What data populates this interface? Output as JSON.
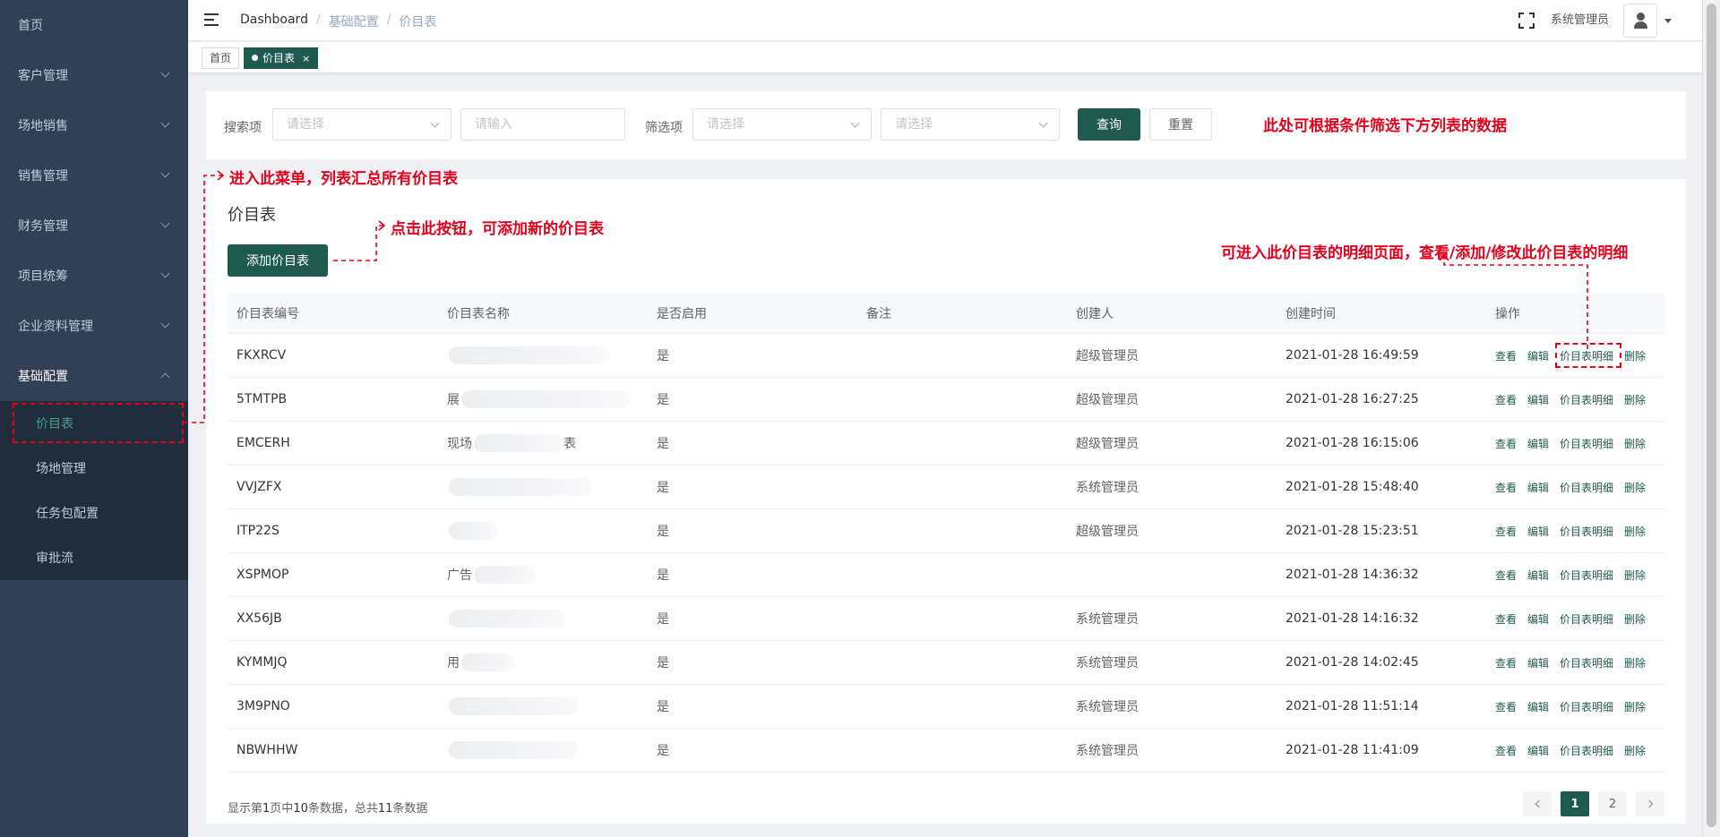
{
  "sidebar": {
    "items": [
      {
        "label": "首页",
        "has_children": false
      },
      {
        "label": "客户管理",
        "has_children": true
      },
      {
        "label": "场地销售",
        "has_children": true
      },
      {
        "label": "销售管理",
        "has_children": true
      },
      {
        "label": "财务管理",
        "has_children": true
      },
      {
        "label": "项目统筹",
        "has_children": true
      },
      {
        "label": "企业资料管理",
        "has_children": true
      },
      {
        "label": "基础配置",
        "has_children": true,
        "expanded": true
      }
    ],
    "sub_items": [
      {
        "label": "价目表",
        "active": true
      },
      {
        "label": "场地管理"
      },
      {
        "label": "任务包配置"
      },
      {
        "label": "审批流"
      }
    ],
    "colors": {
      "bg": "#304156",
      "sub_bg": "#1f2d3d",
      "active_text": "#4fa08a"
    }
  },
  "header": {
    "breadcrumb": [
      "Dashboard",
      "基础配置",
      "价目表"
    ],
    "username": "系统管理员"
  },
  "tags": [
    {
      "label": "首页",
      "active": false
    },
    {
      "label": "价目表",
      "active": true,
      "close": "×"
    }
  ],
  "filter": {
    "search_label": "搜索项",
    "search_select_placeholder": "请选择",
    "search_input_placeholder": "请输入",
    "filter_label": "筛选项",
    "filter_select1_placeholder": "请选择",
    "filter_select2_placeholder": "请选择",
    "query_button": "查询",
    "reset_button": "重置"
  },
  "annotations": {
    "filter_note": "此处可根据条件筛选下方列表的数据",
    "menu_note": "进入此菜单，列表汇总所有价目表",
    "add_note": "点击此按钮，可添加新的价目表",
    "detail_note": "可进入此价目表的明细页面，查看/添加/修改此价目表的明细"
  },
  "main": {
    "title": "价目表",
    "add_button": "添加价目表"
  },
  "table": {
    "columns": [
      "价目表编号",
      "价目表名称",
      "是否启用",
      "备注",
      "创建人",
      "创建时间",
      "操作"
    ],
    "op_labels": {
      "view": "查看",
      "edit": "编辑",
      "detail": "价目表明细",
      "delete": "删除"
    },
    "rows": [
      {
        "code": "FKXRCV",
        "name": "",
        "enabled": "是",
        "remark": "",
        "creator": "超级管理员",
        "created": "2021-01-28 16:49:59"
      },
      {
        "code": "5TMTPB",
        "name": "展",
        "enabled": "是",
        "remark": "",
        "creator": "超级管理员",
        "created": "2021-01-28 16:27:25"
      },
      {
        "code": "EMCERH",
        "name": "现场",
        "name_tail": "表",
        "enabled": "是",
        "remark": "",
        "creator": "超级管理员",
        "created": "2021-01-28 16:15:06"
      },
      {
        "code": "VVJZFX",
        "name": "",
        "enabled": "是",
        "remark": "",
        "creator": "系统管理员",
        "created": "2021-01-28 15:48:40"
      },
      {
        "code": "ITP22S",
        "name": "",
        "enabled": "是",
        "remark": "",
        "creator": "超级管理员",
        "created": "2021-01-28 15:23:51"
      },
      {
        "code": "XSPMOP",
        "name": "广告",
        "enabled": "是",
        "remark": "",
        "creator": "",
        "created": "2021-01-28 14:36:32"
      },
      {
        "code": "XX56JB",
        "name": "",
        "enabled": "是",
        "remark": "",
        "creator": "系统管理员",
        "created": "2021-01-28 14:16:32"
      },
      {
        "code": "KYMMJQ",
        "name": "用",
        "enabled": "是",
        "remark": "",
        "creator": "系统管理员",
        "created": "2021-01-28 14:02:45"
      },
      {
        "code": "3M9PNO",
        "name": "",
        "enabled": "是",
        "remark": "",
        "creator": "系统管理员",
        "created": "2021-01-28 11:51:14"
      },
      {
        "code": "NBWHHW",
        "name": "",
        "enabled": "是",
        "remark": "",
        "creator": "系统管理员",
        "created": "2021-01-28 11:41:09"
      }
    ]
  },
  "footer": {
    "p1": "显示第",
    "page": "1",
    "p2": "页中",
    "count": "10",
    "p3": "条数据，总共",
    "total": "11",
    "p4": "条数据"
  },
  "pagination": {
    "pages": [
      "1",
      "2"
    ],
    "current": "1"
  },
  "colors": {
    "primary": "#1f5a4e",
    "annotation": "#e4001b"
  }
}
